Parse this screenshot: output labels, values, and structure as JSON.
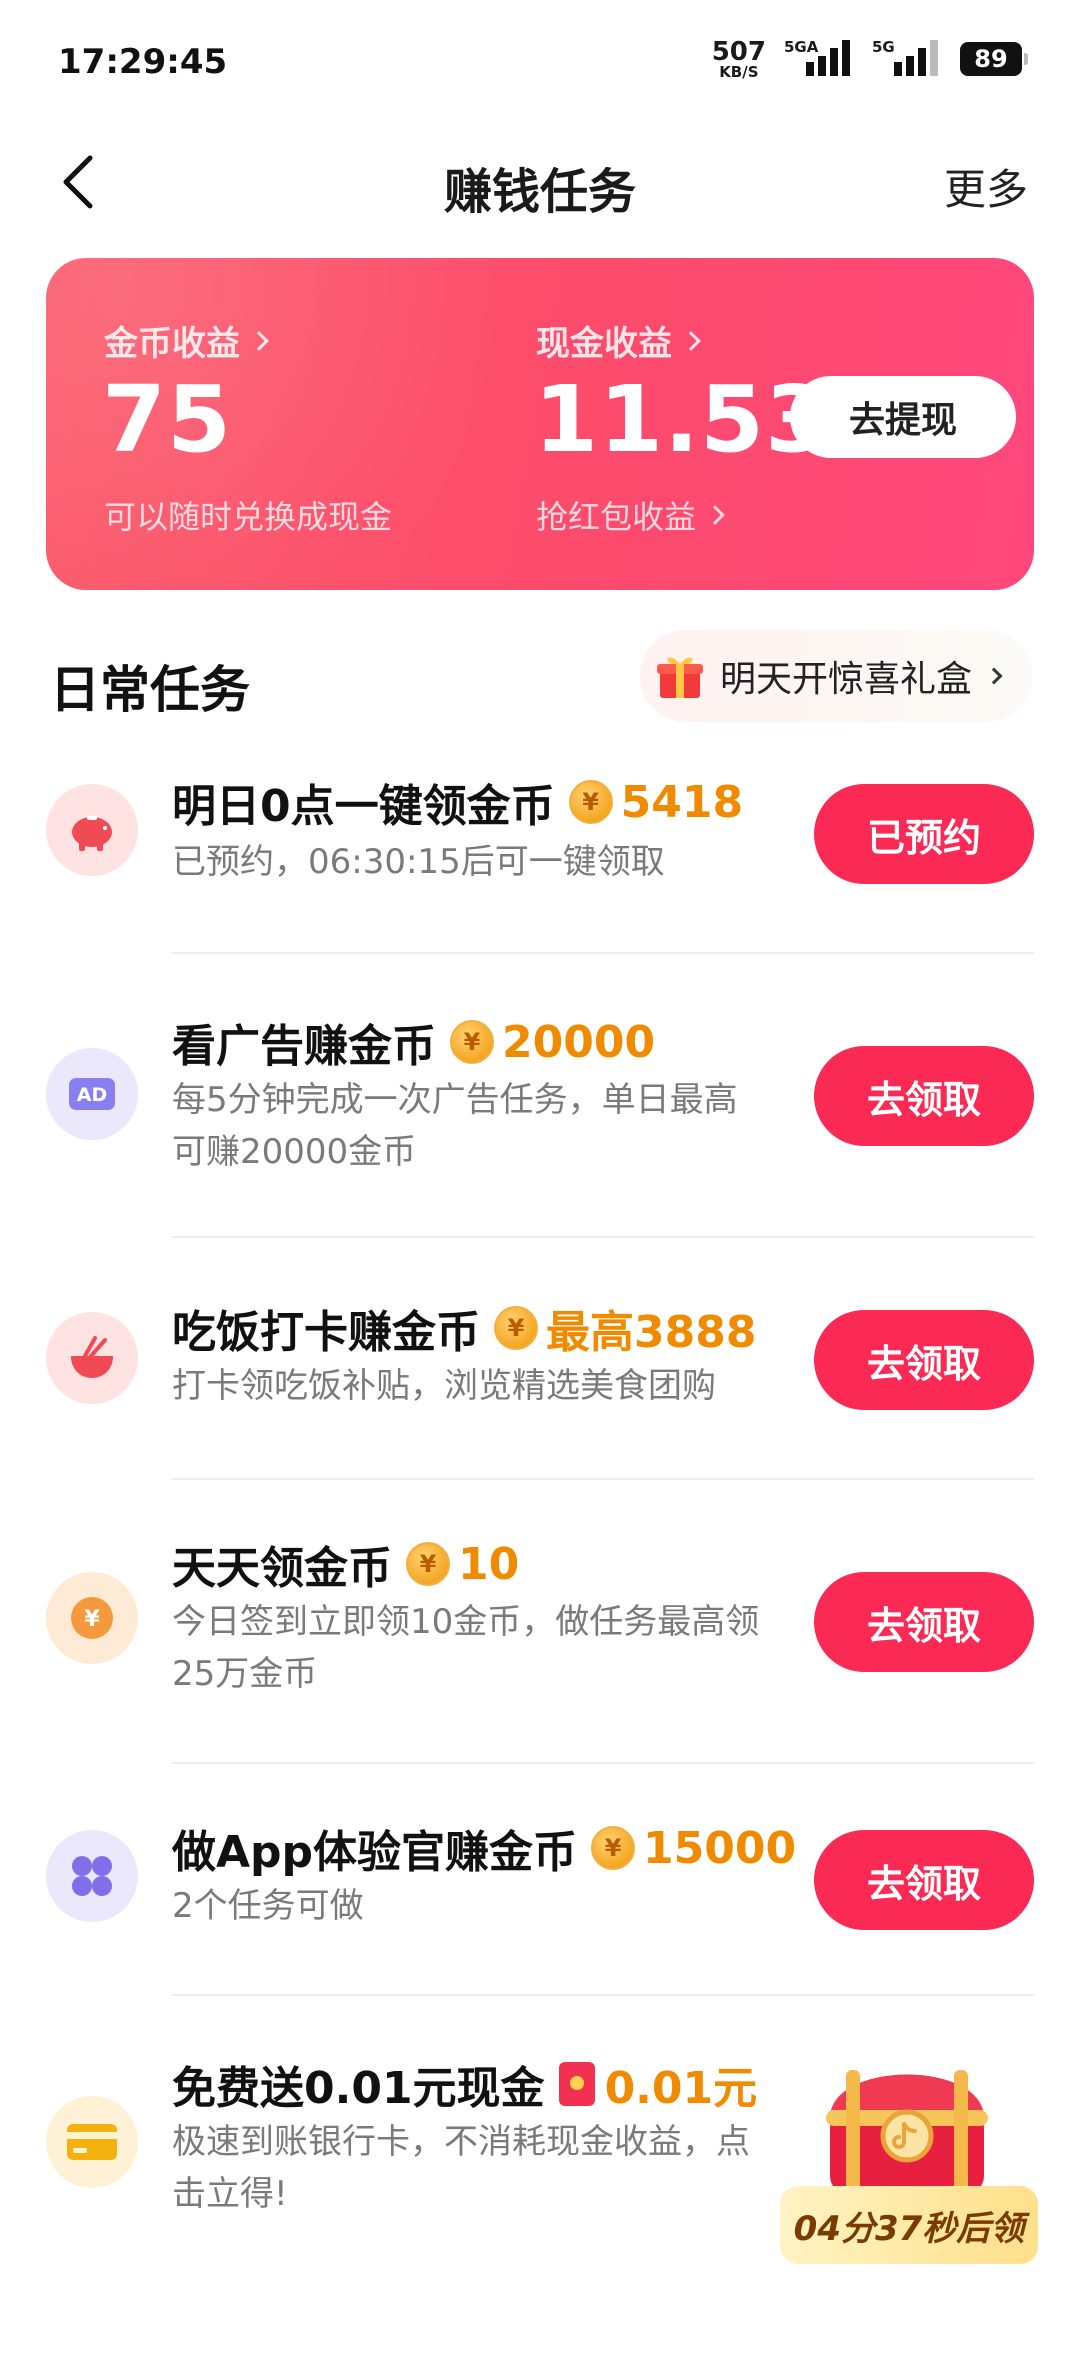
{
  "status_bar": {
    "time": "17:29:45",
    "net_speed_value": "507",
    "net_speed_unit": "KB/S",
    "sim1_label": "5GA",
    "sim2_label": "5G",
    "battery": "89"
  },
  "nav": {
    "title": "赚钱任务",
    "more": "更多"
  },
  "earnings": {
    "coin_label": "金币收益",
    "coin_value": "75",
    "coin_sub": "可以随时兑换成现金",
    "cash_label": "现金收益",
    "cash_value": "11.53",
    "cash_sub": "抢红包收益",
    "withdraw_button": "去提现"
  },
  "daily": {
    "section_title": "日常任务",
    "gift_text": "明天开惊喜礼盒"
  },
  "tasks": [
    {
      "icon": "piggy-bank-icon",
      "title": "明日0点一键领金币",
      "reward": "5418",
      "desc": "已预约，06:30:15后可一键领取",
      "button": "已预约"
    },
    {
      "icon": "ad-icon",
      "title": "看广告赚金币",
      "reward": "20000",
      "desc": "每5分钟完成一次广告任务，单日最高可赚20000金币",
      "button": "去领取"
    },
    {
      "icon": "bowl-icon",
      "title": "吃饭打卡赚金币",
      "reward": "最高3888",
      "desc": "打卡领吃饭补贴，浏览精选美食团购",
      "button": "去领取"
    },
    {
      "icon": "yuan-coin-icon",
      "title": "天天领金币",
      "reward": "10",
      "desc": "今日签到立即领10金币，做任务最高领25万金币",
      "button": "去领取"
    },
    {
      "icon": "apps-grid-icon",
      "title": "做App体验官赚金币",
      "reward": "15000",
      "desc": "2个任务可做",
      "button": "去领取"
    },
    {
      "icon": "bank-card-icon",
      "title": "免费送0.01元现金",
      "reward": "0.01元",
      "desc": "极速到账银行卡，不消耗现金收益，点击立得!"
    }
  ],
  "chest_timer": "04分37秒后领",
  "coin_glyph": "¥",
  "colors": {
    "accent_red": "#fa2a55",
    "card_gradient_start": "#fb5a6a",
    "card_gradient_end": "#ff477d",
    "reward_orange": "#f08a00"
  }
}
